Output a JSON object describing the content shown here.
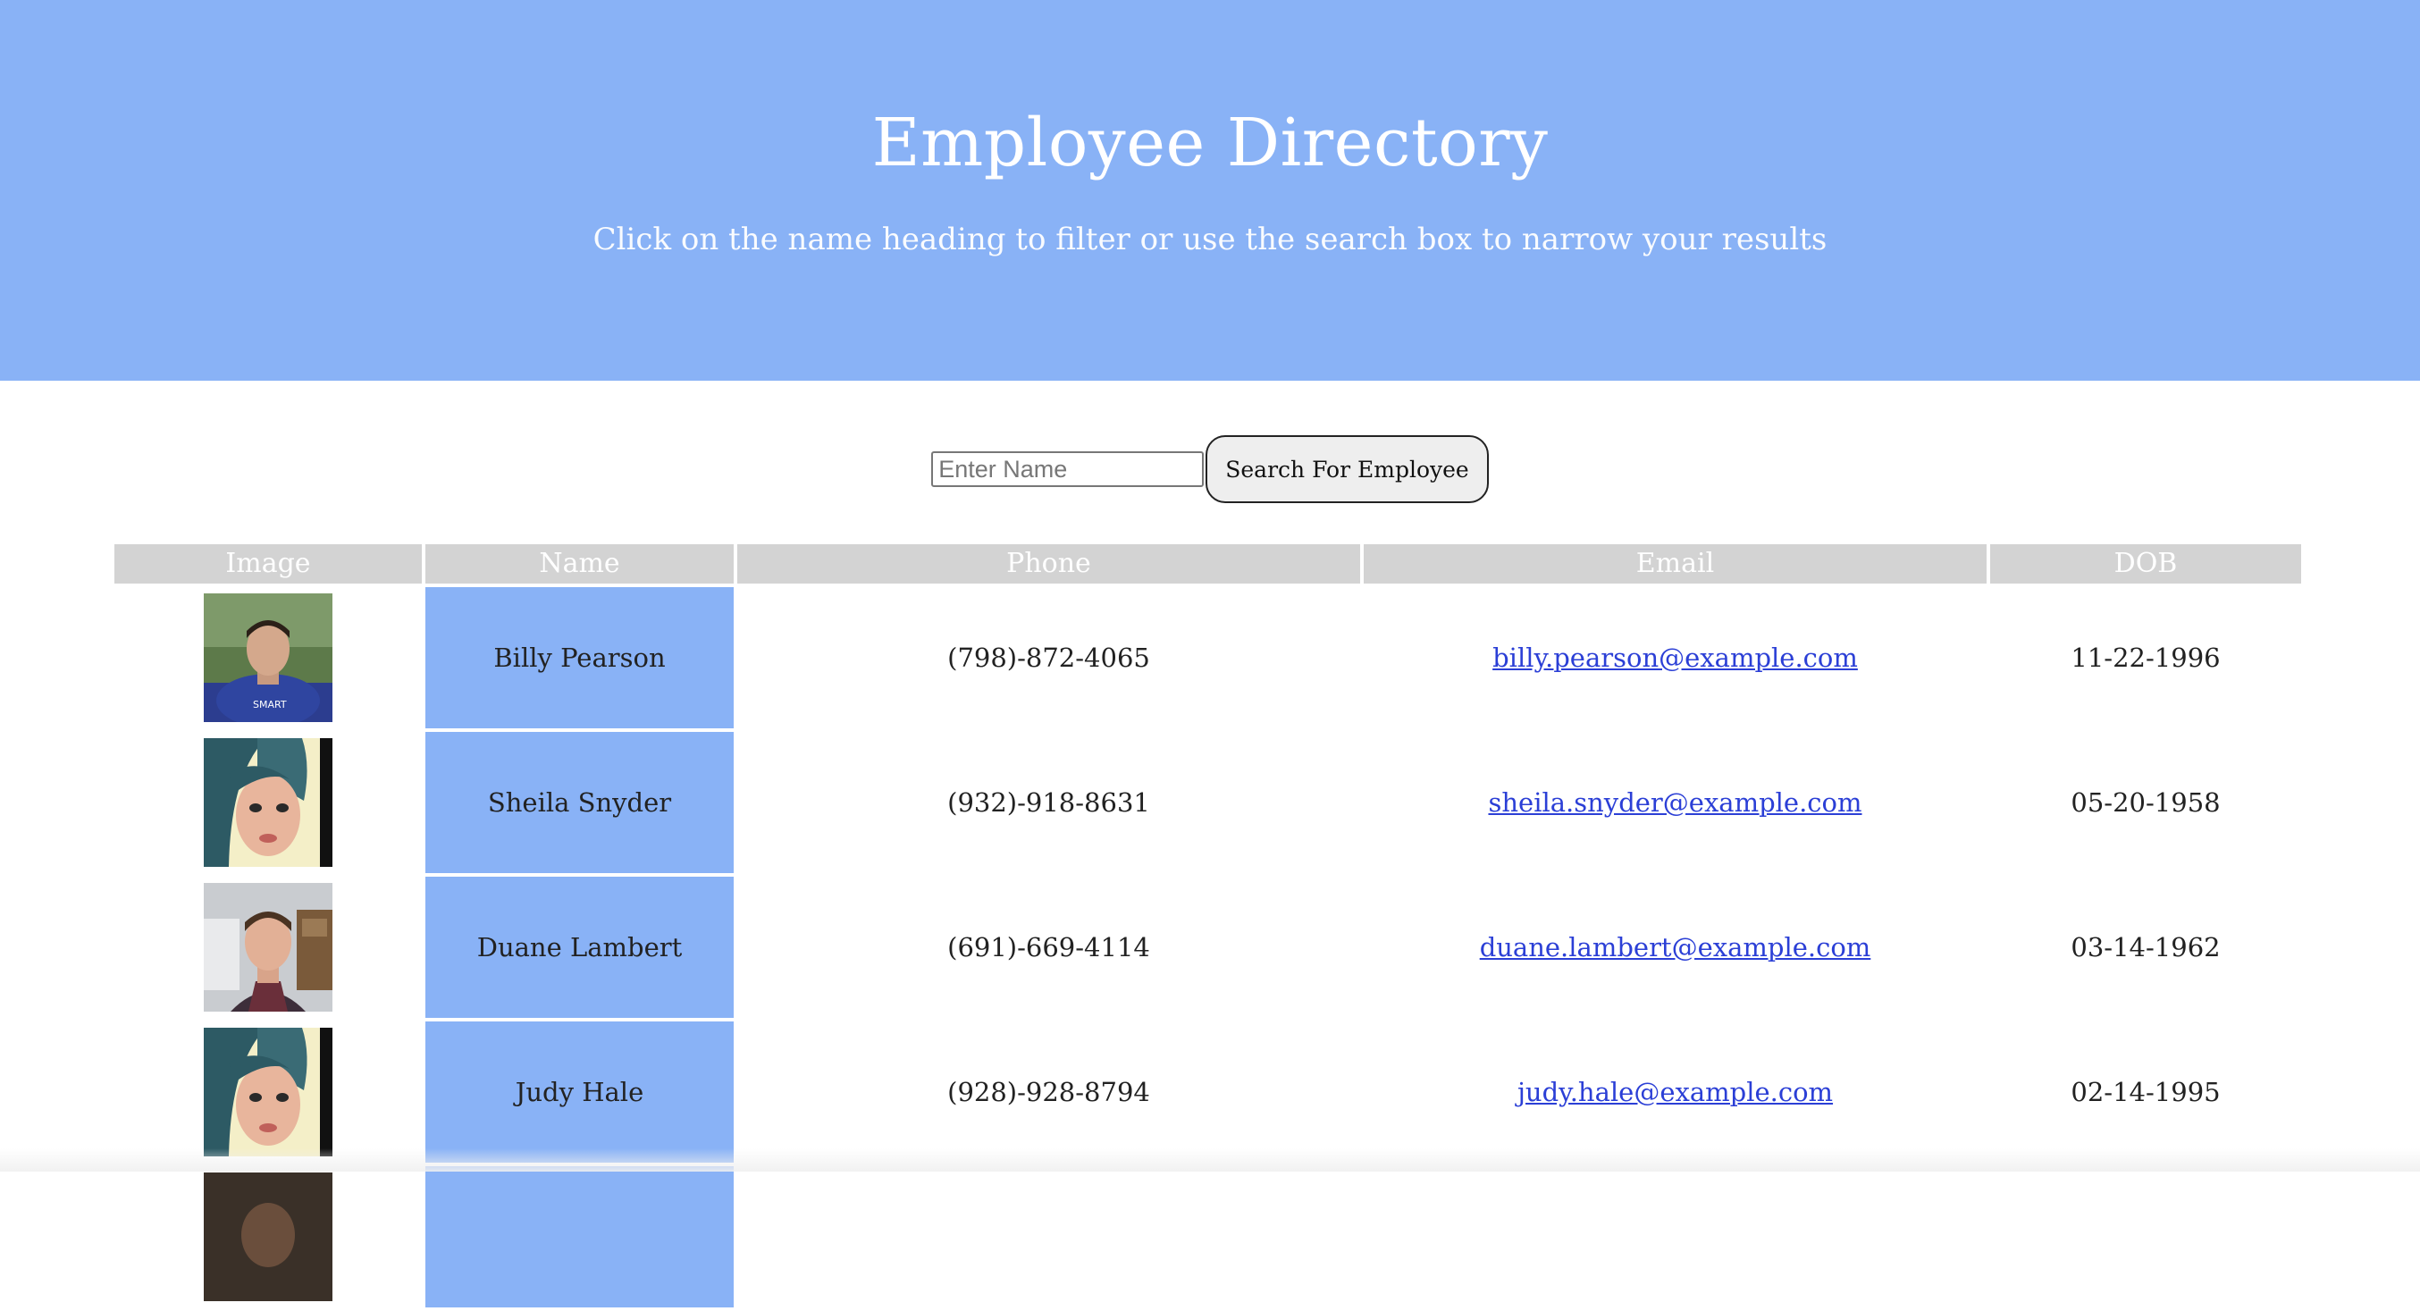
{
  "header": {
    "title": "Employee Directory",
    "subtitle": "Click on the name heading to filter or use the search box to narrow your results"
  },
  "search": {
    "placeholder": "Enter Name",
    "value": "",
    "button_label": "Search For Employee"
  },
  "table": {
    "columns": [
      "Image",
      "Name",
      "Phone",
      "Email",
      "DOB"
    ],
    "rows": [
      {
        "image": "man-blue-shirt-outdoors-photo",
        "name": "Billy Pearson",
        "phone": "(798)-872-4065",
        "email": "billy.pearson@example.com",
        "dob": "11-22-1996"
      },
      {
        "image": "woman-teal-hair-selfie-photo",
        "name": "Sheila Snyder",
        "phone": "(932)-918-8631",
        "email": "sheila.snyder@example.com",
        "dob": "05-20-1958"
      },
      {
        "image": "man-plaid-shirt-office-photo",
        "name": "Duane Lambert",
        "phone": "(691)-669-4114",
        "email": "duane.lambert@example.com",
        "dob": "03-14-1962"
      },
      {
        "image": "woman-teal-hair-selfie-photo",
        "name": "Judy Hale",
        "phone": "(928)-928-8794",
        "email": "judy.hale@example.com",
        "dob": "02-14-1995"
      },
      {
        "image": "man-dark-photo",
        "name": "",
        "phone": "",
        "email": "",
        "dob": ""
      }
    ]
  },
  "colors": {
    "accent": "#89b2f6",
    "header_cell": "#d3d3d3",
    "link": "#2b3fd6"
  }
}
